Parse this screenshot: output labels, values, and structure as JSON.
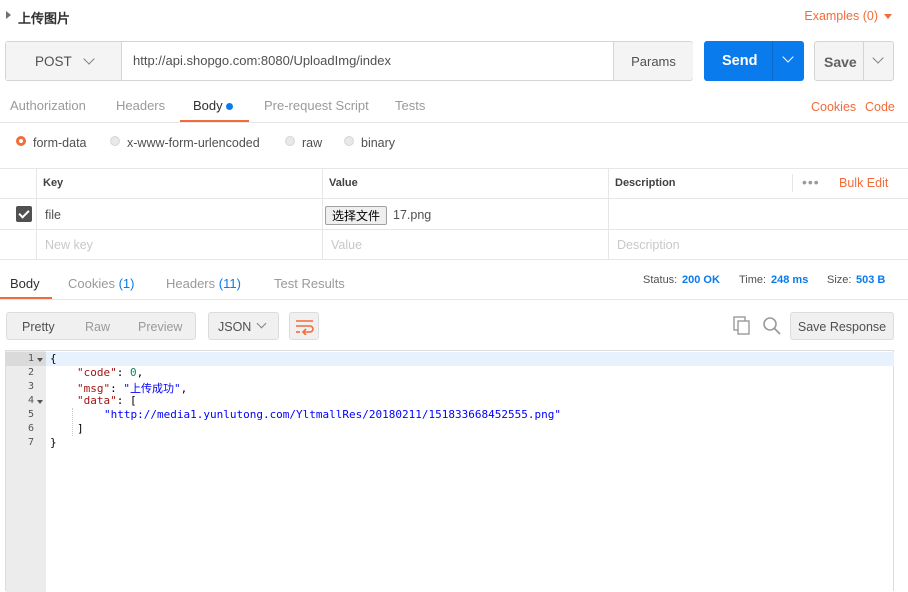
{
  "title_row": {
    "title": "上传图片",
    "examples_label": "Examples (0)"
  },
  "request": {
    "method": "POST",
    "url": "http://api.shopgo.com:8080/UploadImg/index",
    "params_label": "Params",
    "send_label": "Send",
    "save_label": "Save"
  },
  "request_tabs": {
    "items": [
      "Authorization",
      "Headers",
      "Body",
      "Pre-request Script",
      "Tests"
    ],
    "active": "Body",
    "cookies_label": "Cookies",
    "code_label": "Code"
  },
  "body_types": {
    "items": [
      "form-data",
      "x-www-form-urlencoded",
      "raw",
      "binary"
    ],
    "selected": "form-data"
  },
  "form_table": {
    "headers": {
      "key": "Key",
      "value": "Value",
      "description": "Description"
    },
    "bulk_edit_label": "Bulk Edit",
    "rows": [
      {
        "checked": true,
        "key": "file",
        "file_button": "选择文件",
        "value": "17.png",
        "description": ""
      }
    ],
    "placeholders": {
      "key": "New key",
      "value": "Value",
      "description": "Description"
    }
  },
  "response_tabs": {
    "body": "Body",
    "cookies": "Cookies",
    "cookies_count": "(1)",
    "headers": "Headers",
    "headers_count": "(11)",
    "test_results": "Test Results"
  },
  "response_meta": {
    "status_label": "Status:",
    "status_value": "200 OK",
    "time_label": "Time:",
    "time_value": "248 ms",
    "size_label": "Size:",
    "size_value": "503 B"
  },
  "response_toolbar": {
    "views": [
      "Pretty",
      "Raw",
      "Preview"
    ],
    "active_view": "Pretty",
    "format": "JSON",
    "save_response_label": "Save Response"
  },
  "response_body": {
    "line_numbers": [
      "1",
      "2",
      "3",
      "4",
      "5",
      "6",
      "7"
    ],
    "brace_open": "{",
    "code_key": "\"code\"",
    "code_value": "0",
    "msg_key": "\"msg\"",
    "msg_value": "\"上传成功\"",
    "data_key": "\"data\"",
    "data_item": "\"http://media1.yunlutong.com/YltmallRes/20180211/151833668452555.png\"",
    "bracket_open": "[",
    "bracket_close": "]",
    "brace_close": "}"
  },
  "colors": {
    "accent": "#f26b3a",
    "send_blue": "#097bed"
  },
  "icons": [
    "caret-right-icon",
    "chevron-down-icon",
    "copy-icon",
    "search-icon",
    "wrap-lines-icon",
    "checkbox-checked-icon",
    "more-dots-icon"
  ]
}
